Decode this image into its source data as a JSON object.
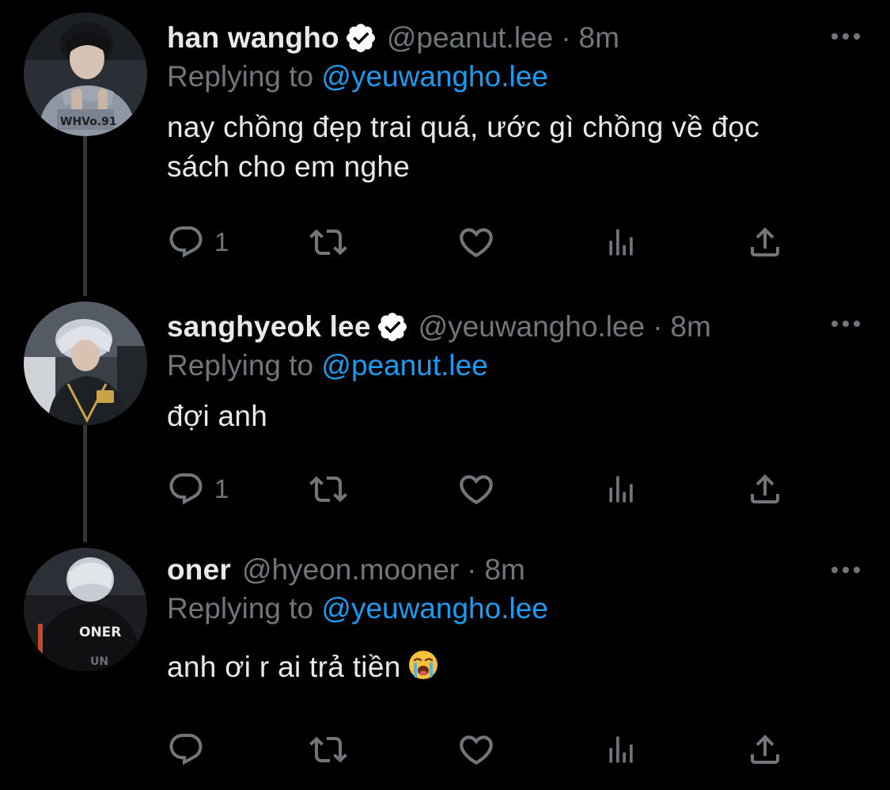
{
  "colors": {
    "background": "#000000",
    "text": "#e7e9ea",
    "muted": "#71767b",
    "link": "#1d9bf0",
    "thread_line": "#333639"
  },
  "tweets": [
    {
      "display_name": "han wangho",
      "verified": true,
      "handle": "@peanut.lee",
      "separator": "·",
      "time": "8m",
      "reply_prefix": "Replying to",
      "reply_to": "@yeuwangho.lee",
      "text": "nay chồng đẹp trai quá, ước gì chồng về đọc sách cho em nghe",
      "reply_count": "1"
    },
    {
      "display_name": "sanghyeok lee",
      "verified": true,
      "handle": "@yeuwangho.lee",
      "separator": "·",
      "time": "8m",
      "reply_prefix": "Replying to",
      "reply_to": "@peanut.lee",
      "text": "đợi anh",
      "reply_count": "1"
    },
    {
      "display_name": "oner",
      "verified": false,
      "handle": "@hyeon.mooner",
      "separator": "·",
      "time": "8m",
      "reply_prefix": "Replying to",
      "reply_to": "@yeuwangho.lee",
      "text": "anh ơi r ai trả tiền",
      "emoji": "loudly-crying-face",
      "reply_count": ""
    }
  ],
  "icons": {
    "reply": "reply-icon",
    "retweet": "retweet-icon",
    "like": "heart-icon",
    "views": "analytics-icon",
    "share": "share-icon",
    "more": "more-icon",
    "verified": "verified-badge-icon"
  },
  "avatars": {
    "t0_jacket_text": "WHVo.91",
    "t2_jersey_text": "ONER",
    "t2_jersey_sleeve": "UN"
  }
}
